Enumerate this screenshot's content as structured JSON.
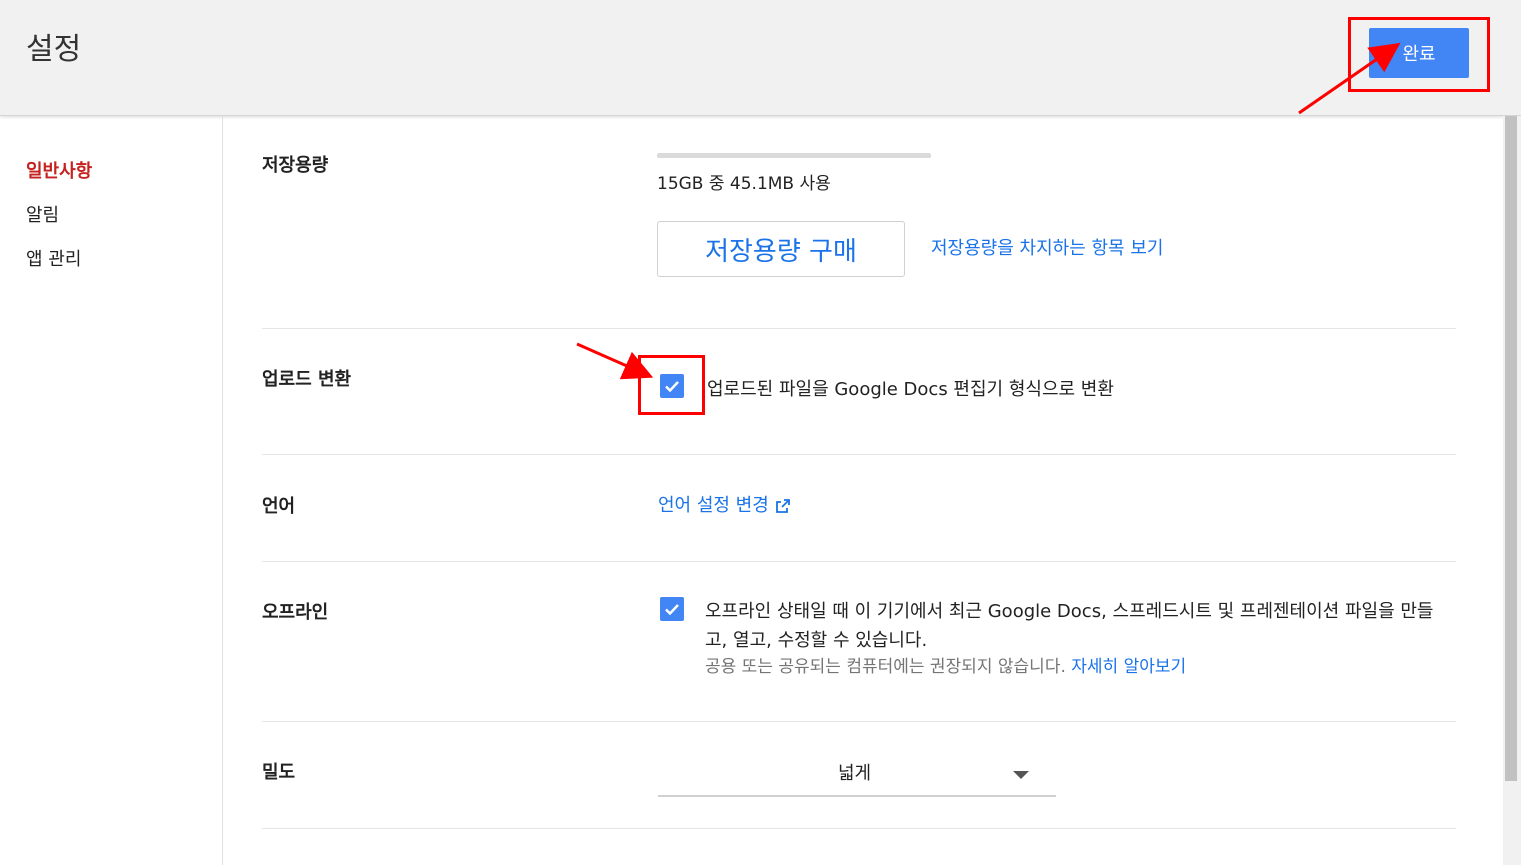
{
  "header": {
    "title": "설정",
    "done_label": "완료",
    "accent_color": "#4285f4"
  },
  "sidebar": {
    "items": [
      {
        "label": "일반사항",
        "active": true
      },
      {
        "label": "알림",
        "active": false
      },
      {
        "label": "앱 관리",
        "active": false
      }
    ]
  },
  "sections": {
    "storage": {
      "label": "저장용량",
      "usage_text": "15GB 중 45.1MB 사용",
      "usage_fraction": 0.003,
      "buy_label": "저장용량 구매",
      "view_link": "저장용량을 차지하는 항목 보기"
    },
    "upload": {
      "label": "업로드 변환",
      "checkbox_text": "업로드된 파일을 Google Docs 편집기 형식으로 변환",
      "checked": true
    },
    "language": {
      "label": "언어",
      "link_text": "언어 설정 변경"
    },
    "offline": {
      "label": "오프라인",
      "checked": true,
      "text": "오프라인 상태일 때 이 기기에서 최근 Google Docs, 스프레드시트 및 프레젠테이션 파일을 만들고, 열고, 수정할 수 있습니다.",
      "sub_text": "공용 또는 공유되는 컴퓨터에는 권장되지 않습니다.",
      "learn_more": "자세히 알아보기"
    },
    "density": {
      "label": "밀도",
      "value": "넓게"
    }
  },
  "annotation_color": "#ff0000"
}
